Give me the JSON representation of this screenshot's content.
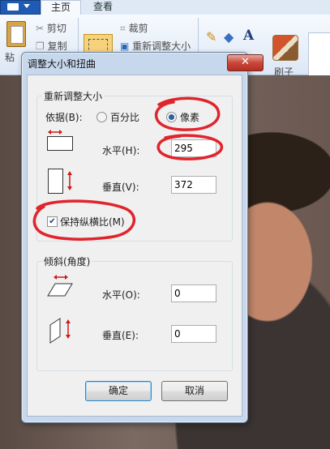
{
  "app": {
    "tabs": {
      "home": "主页",
      "view": "查看"
    },
    "ribbon": {
      "paste": "粘",
      "cut": "剪切",
      "copy": "复制",
      "crop": "裁剪",
      "resize": "重新调整大小",
      "brushes": "刷子"
    }
  },
  "dialog": {
    "title": "调整大小和扭曲",
    "close_label": "✕",
    "resize": {
      "group_title": "重新调整大小",
      "by_label": "依据(B):",
      "percent_label": "百分比",
      "pixels_label": "像素",
      "selected_unit": "pixels",
      "horizontal_label": "水平(H):",
      "horizontal_value": "295",
      "vertical_label": "垂直(V):",
      "vertical_value": "372",
      "keep_aspect_label": "保持纵横比(M)",
      "keep_aspect_checked": true
    },
    "skew": {
      "group_title": "倾斜(角度)",
      "horizontal_label": "水平(O):",
      "horizontal_value": "0",
      "vertical_label": "垂直(E):",
      "vertical_value": "0"
    },
    "ok_label": "确定",
    "cancel_label": "取消"
  },
  "colors": {
    "annotation": "#e0242c",
    "arrow": "#cc1a1a"
  }
}
